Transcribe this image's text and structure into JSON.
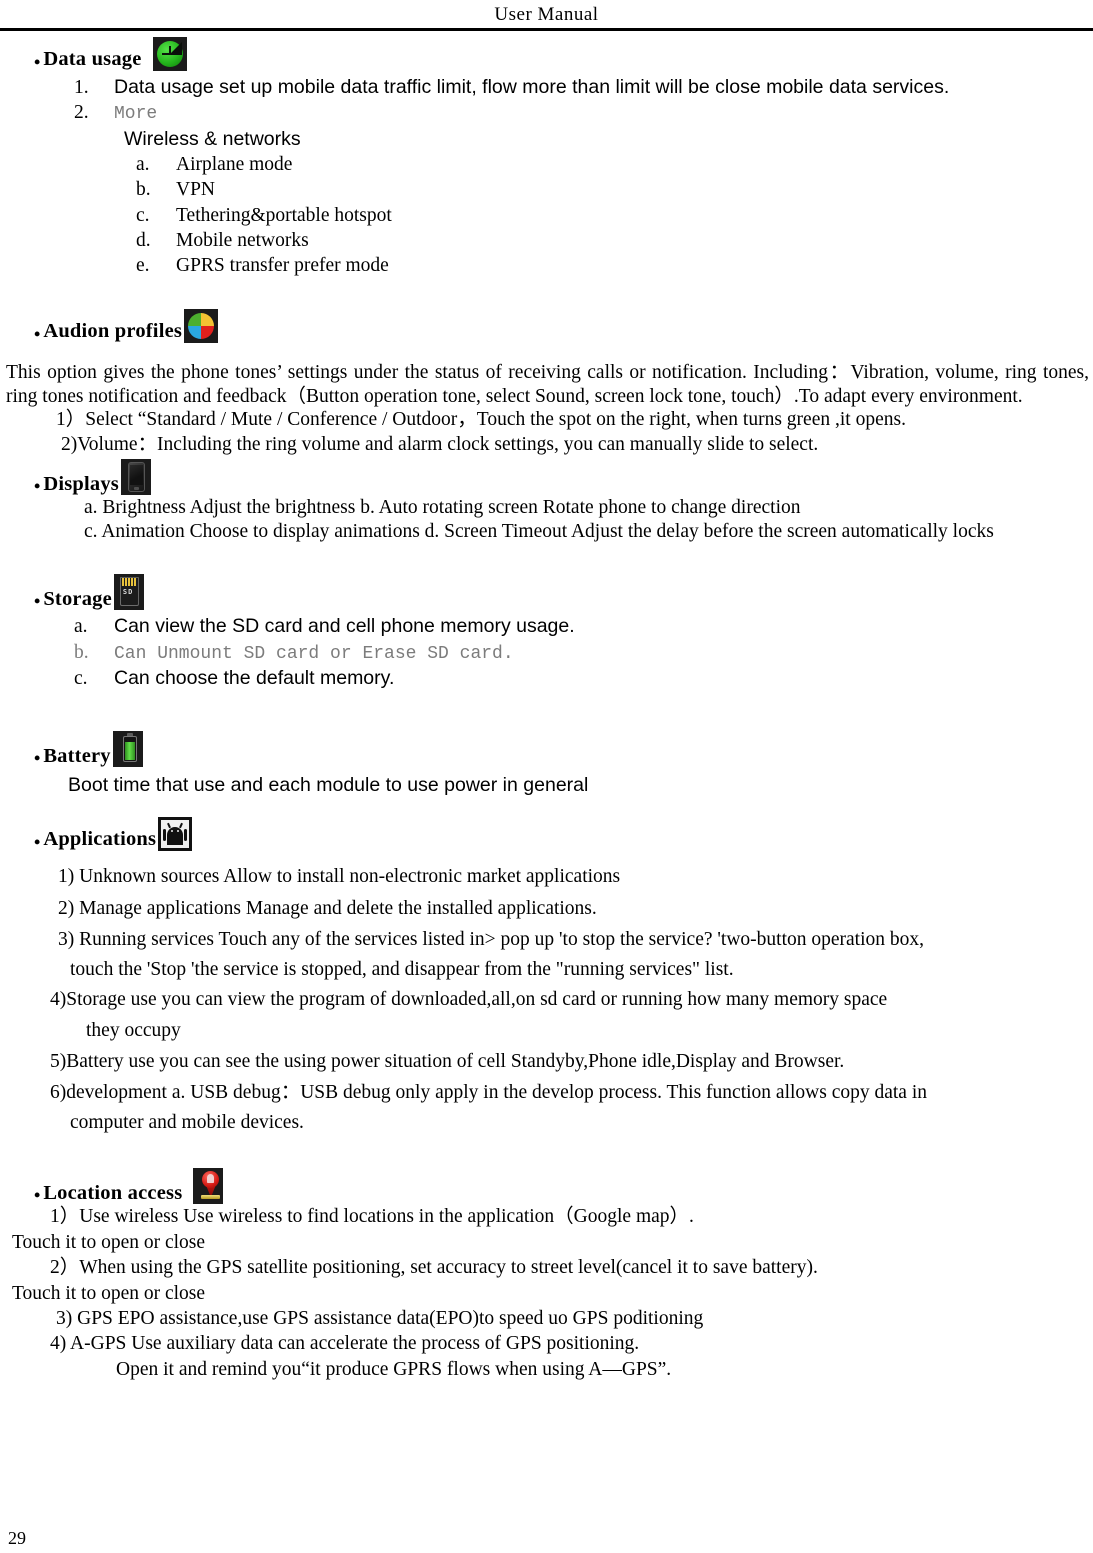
{
  "header": {
    "title": "User    Manual"
  },
  "page_number": "29",
  "sections": {
    "data_usage": {
      "heading": "Data usage",
      "icon": "data-usage-icon",
      "item1_marker": "1.",
      "item1": "Data usage    set up mobile data traffic limit, flow more than limit will be close mobile data services.",
      "item2_marker": "2.",
      "item2": "More",
      "subheading": "Wireless & networks",
      "sub_items": [
        {
          "marker": "a.",
          "label": "Airplane mode"
        },
        {
          "marker": "b.",
          "label": "VPN"
        },
        {
          "marker": "c.",
          "label": "Tethering&portable hotspot"
        },
        {
          "marker": "d.",
          "label": "Mobile networks"
        },
        {
          "marker": "e.",
          "label": "GPRS transfer prefer mode"
        }
      ]
    },
    "audio_profiles": {
      "heading": "Audion profiles",
      "icon": "audio-profiles-icon",
      "paragraph": "This option gives the phone tones’ settings under the status of receiving calls or notification. Including：Vibration, volume, ring tones, ring tones notification and feedback（Button operation tone, select Sound, screen lock tone, touch）.To adapt every environment.",
      "item1": "1）Select  “Standard / Mute / Conference / Outdoor，Touch the spot on the right, when turns green ,it opens.",
      "item2": "2)Volume：Including the ring volume and alarm clock settings, you can manually slide to select."
    },
    "displays": {
      "heading": "Displays",
      "icon": "display-icon",
      "line1": "a. Brightness Adjust the brightness      b. Auto rotating screen    Rotate phone to change direction",
      "line2": "c. Animation      Choose to display animations     d. Screen Timeout     Adjust the delay before the screen automatically locks"
    },
    "storage": {
      "heading": "Storage",
      "icon": "sd-card-icon",
      "items": [
        {
          "marker": "a.",
          "label": "Can view the SD card and cell phone memory usage.",
          "style": "sans"
        },
        {
          "marker": "b.",
          "label": "Can Unmount SD card or Erase SD card.",
          "style": "mono-gray"
        },
        {
          "marker": "c.",
          "label": "Can choose the default memory.",
          "style": "sans"
        }
      ]
    },
    "battery": {
      "heading": "Battery",
      "icon": "battery-icon",
      "line": "Boot time that use and each module to use power in general"
    },
    "applications": {
      "heading": "Applications",
      "icon": "android-robot-icon",
      "items": [
        "1) Unknown sources              Allow to install non-electronic market applications",
        "2) Manage applications          Manage and delete the installed applications.",
        "3) Running services      Touch any of the services listed in&gt; pop up 'to stop the service? 'two-button operation box, touch the 'Stop 'the service is stopped, and disappear from the \"running services\" list.",
        "4)Storage use         you can view the program of downloaded,all,on sd card or running    how many memory space they occupy",
        "5)Battery use         you can see the using power situation of cell Standyby,Phone idle,Display and Browser.",
        "6)development          a. USB debug：USB debug only apply in the develop process. This function allows copy data in computer and mobile devices."
      ],
      "item_3_line1": "3) Running services      Touch any of the services listed in> pop up 'to stop the service? 'two-button operation box,",
      "item_3_line2": "touch the 'Stop 'the service is stopped, and disappear from the \"running services\" list.",
      "item_4_line1": "4)Storage use         you can view the program of downloaded,all,on sd card or running    how many memory space",
      "item_4_line2": "they occupy",
      "item_6_line1": "6)development          a. USB debug：USB debug only apply in the develop process. This function allows copy data in",
      "item_6_line2": "computer and mobile devices."
    },
    "location_access": {
      "heading": "Location   access",
      "icon": "location-pin-icon",
      "line1": "1）Use wireless   Use wireless to find locations in the application（Google map）.",
      "line2": "Touch it to open or close",
      "line3": "2）When using the GPS satellite positioning, set accuracy to street level(cancel it to save battery).",
      "line4": "Touch it to open or close",
      "line5": "3) GPS EPO assistance,use GPS assistance data(EPO)to speed uo GPS poditioning",
      "line6": "4) A-GPS     Use auxiliary data can accelerate the process of GPS positioning.",
      "line7": "Open it and remind you“it produce GPRS flows when using A—GPS”."
    }
  }
}
